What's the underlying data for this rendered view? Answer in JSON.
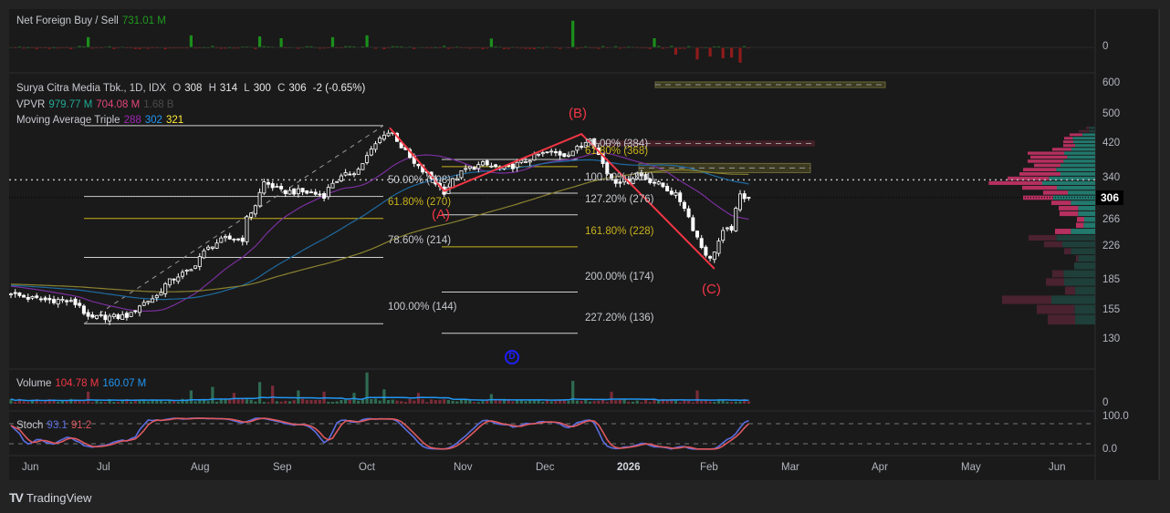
{
  "foreign": {
    "label": "Net Foreign Buy / Sell",
    "value": "731.01 M",
    "axis_zero": "0"
  },
  "symbol": {
    "name": "Surya Citra Media Tbk., 1D, IDX",
    "o_label": "O",
    "o": "308",
    "h_label": "H",
    "h": "314",
    "l_label": "L",
    "l": "300",
    "c_label": "C",
    "c": "306",
    "change": "-2 (-0.65%)"
  },
  "vpvr": {
    "label": "VPVR",
    "up": "979.77 M",
    "down": "704.08 M",
    "total": "1.68 B"
  },
  "ma": {
    "label": "Moving Average Triple",
    "fast": "288",
    "mid": "302",
    "slow": "321"
  },
  "volume": {
    "label": "Volume",
    "value": "104.78 M",
    "ma": "160.07 M",
    "axis_zero": "0"
  },
  "stoch": {
    "label": "Stoch",
    "k": "93.1",
    "d": "91.2",
    "axis_top": "100.0",
    "axis_bottom": "0.0"
  },
  "last_price": "306",
  "dividend_marker": "D",
  "waves": {
    "a": "(A)",
    "b": "(B)",
    "c": "(C)"
  },
  "brand": "TradingView",
  "colors": {
    "up_volume": "#2f6b52",
    "down_volume": "#7a2b37",
    "ma_fast": "#7b2f9e",
    "ma_mid": "#1f6aa0",
    "ma_slow": "#8a8230",
    "wave": "#f23645",
    "stoch_k": "#5b6ee1",
    "stoch_d": "#e0595f",
    "fib_gold": "#c9b21d",
    "vp_up": "#22796e",
    "vp_down": "#b5305f"
  },
  "chart_data": {
    "type": "candlestick",
    "title": "Surya Citra Media Tbk., 1D, IDX",
    "y_scale": "log",
    "ylim": [
      120,
      620
    ],
    "y_ticks": [
      "600",
      "500",
      "420",
      "340",
      "306",
      "266",
      "226",
      "185",
      "155",
      "130"
    ],
    "x_ticks": [
      "Jun",
      "Jul",
      "Aug",
      "Sep",
      "Oct",
      "Nov",
      "Dec",
      "2026",
      "Feb",
      "Mar",
      "Apr",
      "May",
      "Jun"
    ],
    "close_keypoints": [
      [
        0,
        172
      ],
      [
        4,
        168
      ],
      [
        8,
        166
      ],
      [
        12,
        166
      ],
      [
        16,
        161
      ],
      [
        18,
        148
      ],
      [
        21,
        150
      ],
      [
        25,
        150
      ],
      [
        28,
        152
      ],
      [
        30,
        161
      ],
      [
        34,
        170
      ],
      [
        36,
        182
      ],
      [
        39,
        192
      ],
      [
        42,
        198
      ],
      [
        44,
        215
      ],
      [
        47,
        231
      ],
      [
        50,
        239
      ],
      [
        54,
        239
      ],
      [
        55,
        269
      ],
      [
        57,
        293
      ],
      [
        59,
        335
      ],
      [
        61,
        327
      ],
      [
        63,
        317
      ],
      [
        67,
        317
      ],
      [
        70,
        314
      ],
      [
        73,
        310
      ],
      [
        75,
        335
      ],
      [
        78,
        349
      ],
      [
        81,
        362
      ],
      [
        84,
        405
      ],
      [
        87,
        450
      ],
      [
        89,
        450
      ],
      [
        91,
        415
      ],
      [
        94,
        373
      ],
      [
        98,
        343
      ],
      [
        101,
        317
      ],
      [
        103,
        338
      ],
      [
        106,
        362
      ],
      [
        110,
        373
      ],
      [
        115,
        362
      ],
      [
        119,
        377
      ],
      [
        123,
        395
      ],
      [
        126,
        400
      ],
      [
        129,
        395
      ],
      [
        133,
        415
      ],
      [
        135,
        441
      ],
      [
        137,
        395
      ],
      [
        139,
        354
      ],
      [
        141,
        338
      ],
      [
        144,
        338
      ],
      [
        146,
        354
      ],
      [
        148,
        343
      ],
      [
        152,
        327
      ],
      [
        155,
        310
      ],
      [
        157,
        290
      ],
      [
        159,
        255
      ],
      [
        161,
        228
      ],
      [
        163,
        211
      ],
      [
        166,
        248
      ],
      [
        168,
        255
      ],
      [
        170,
        310
      ],
      [
        172,
        306
      ]
    ],
    "ma_periods": [
      20,
      50,
      100
    ],
    "fib_retracement": [
      {
        "label": "50.00% (308)",
        "price": 308
      },
      {
        "label": "61.80% (270)",
        "price": 270,
        "gold": true
      },
      {
        "label": "78.60% (214)",
        "price": 214
      },
      {
        "label": "100.00% (144)",
        "price": 144
      }
    ],
    "fib_extension": [
      {
        "label": "50.00% (384)",
        "price": 384
      },
      {
        "label": "61.80% (368)",
        "price": 368,
        "gold": true
      },
      {
        "label": "100.00% (314)",
        "price": 314
      },
      {
        "label": "127.20% (276)",
        "price": 276
      },
      {
        "label": "161.80% (228)",
        "price": 228,
        "gold": true
      },
      {
        "label": "200.00% (174)",
        "price": 174
      },
      {
        "label": "227.20% (136)",
        "price": 136
      }
    ],
    "abc_wave": [
      [
        0,
        "start",
        464
      ],
      [
        101,
        "A",
        318
      ],
      [
        133,
        "B",
        447
      ],
      [
        164,
        "C",
        200
      ]
    ],
    "zones": [
      {
        "top": 610,
        "bottom": 590
      },
      {
        "top": 430,
        "bottom": 415
      },
      {
        "top": 375,
        "bottom": 355
      }
    ],
    "poc_price": 340,
    "vpvr_rows": {
      "low": 143,
      "step": 9.3,
      "rows_top_down": [
        [
          20,
          10,
          0
        ],
        [
          20,
          34,
          0
        ],
        [
          42,
          42,
          1
        ],
        [
          74,
          28,
          1
        ],
        [
          72,
          33,
          1
        ],
        [
          66,
          39,
          1
        ],
        [
          78,
          63,
          1
        ],
        [
          102,
          120,
          1
        ],
        [
          92,
          121,
          1
        ],
        [
          104,
          118,
          1
        ],
        [
          114,
          87,
          1
        ],
        [
          128,
          109,
          1
        ],
        [
          114,
          135,
          1
        ],
        [
          152,
          136,
          1
        ],
        [
          174,
          176,
          1
        ],
        [
          126,
          114,
          1
        ],
        [
          90,
          81,
          1
        ],
        [
          138,
          99,
          1
        ],
        [
          80,
          64,
          1
        ],
        [
          56,
          64,
          1
        ],
        [
          56,
          61,
          1
        ],
        [
          36,
          24,
          1
        ],
        [
          38,
          25,
          1
        ],
        [
          80,
          52,
          1
        ],
        [
          128,
          91,
          0
        ],
        [
          108,
          60,
          0
        ],
        [
          80,
          22,
          0
        ],
        [
          56,
          7,
          0
        ],
        [
          69,
          0,
          0
        ],
        [
          104,
          37,
          0
        ],
        [
          102,
          60,
          0
        ],
        [
          66,
          33,
          0
        ],
        [
          144,
          162,
          0
        ],
        [
          68,
          124,
          0
        ],
        [
          66,
          90,
          0
        ]
      ]
    },
    "volume_spikes": [
      [
        18,
        500
      ],
      [
        42,
        550
      ],
      [
        47,
        700
      ],
      [
        52,
        450
      ],
      [
        58,
        900
      ],
      [
        61,
        750
      ],
      [
        67,
        550
      ],
      [
        73,
        500
      ],
      [
        80,
        450
      ],
      [
        83,
        1300
      ],
      [
        87,
        600
      ],
      [
        95,
        450
      ],
      [
        112,
        400
      ],
      [
        131,
        950
      ],
      [
        140,
        500
      ],
      [
        160,
        550
      ]
    ],
    "foreign_spikes": [
      [
        18,
        280
      ],
      [
        42,
        330
      ],
      [
        58,
        300
      ],
      [
        63,
        250
      ],
      [
        75,
        280
      ],
      [
        83,
        330
      ],
      [
        112,
        240
      ],
      [
        131,
        731
      ],
      [
        150,
        250
      ],
      [
        155,
        -200
      ],
      [
        160,
        -330
      ],
      [
        163,
        -250
      ],
      [
        166,
        -300
      ],
      [
        168,
        -280
      ],
      [
        170,
        -420
      ]
    ]
  }
}
